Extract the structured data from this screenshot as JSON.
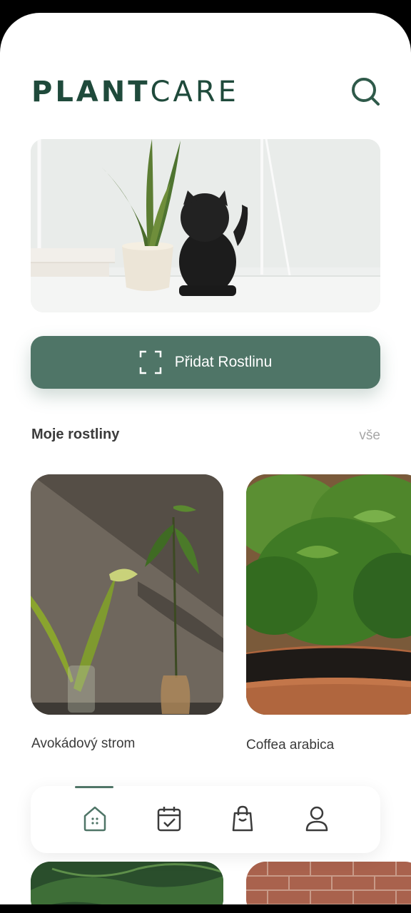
{
  "header": {
    "logo_part1": "PLANT",
    "logo_part2": "CARE"
  },
  "hero": {
    "image": "plant-and-lucky-cat-on-shelf"
  },
  "add_plant": {
    "label": "Přidat Rostlinu",
    "icon": "scan-icon"
  },
  "my_plants": {
    "title": "Moje rostliny",
    "see_all": "vše",
    "items": [
      {
        "name": "Avokádový strom"
      },
      {
        "name": "Coffea arabica"
      }
    ]
  },
  "bottom_nav": {
    "items": [
      {
        "icon": "home-icon",
        "active": true
      },
      {
        "icon": "calendar-icon",
        "active": false
      },
      {
        "icon": "shopping-bag-icon",
        "active": false
      },
      {
        "icon": "profile-icon",
        "active": false
      }
    ]
  },
  "colors": {
    "brand_dark": "#1f4a3b",
    "accent": "#4f7567"
  }
}
